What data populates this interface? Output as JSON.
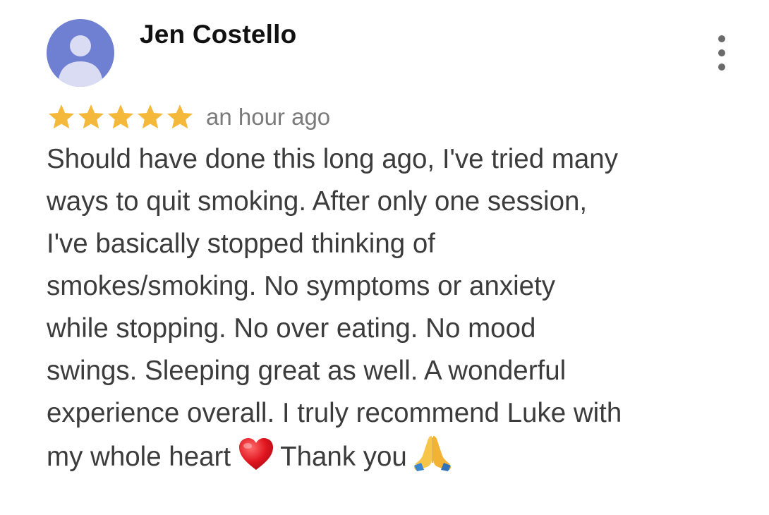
{
  "review": {
    "reviewer_name": "Jen Costello",
    "avatar_icon": "person-silhouette-icon",
    "avatar_color": "#6f7fd1",
    "rating": 5,
    "rating_max": 5,
    "star_color": "#f4b93b",
    "timestamp": "an hour ago",
    "menu_icon": "more-vertical-icon",
    "text_lines": [
      "Should have done this long ago, I've tried many",
      "ways to quit smoking. After only one session,",
      "I've basically stopped thinking of",
      "smokes/smoking. No symptoms or anxiety",
      "while stopping. No over eating. No mood",
      "swings. Sleeping great as well. A wonderful",
      "experience overall. I truly recommend Luke with"
    ],
    "last_line": {
      "part1": "my whole heart",
      "emoji1": "red-heart-icon",
      "part2": "Thank you",
      "emoji2": "folded-hands-icon"
    }
  }
}
